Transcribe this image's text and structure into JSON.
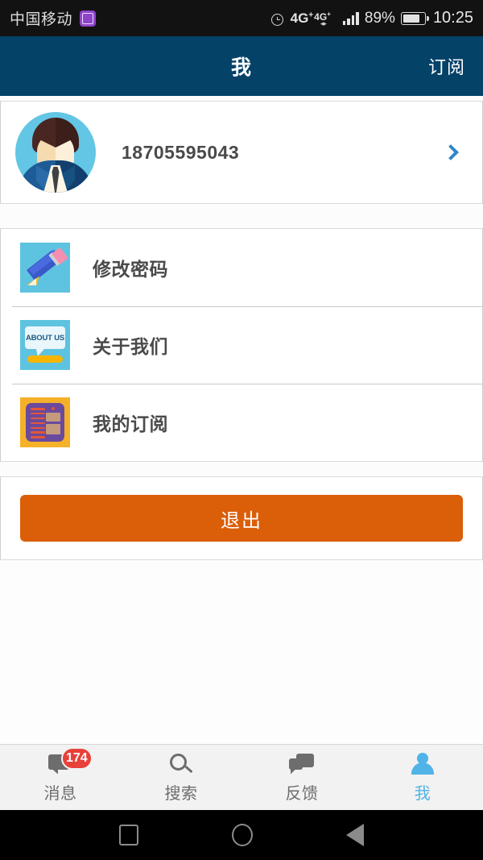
{
  "status_bar": {
    "carrier": "中国移动",
    "sim_icon": "sim-card-icon",
    "alarm_icon": "alarm-clock-icon",
    "network_primary": "4G",
    "network_primary_sup": "+",
    "network_secondary": "4G",
    "network_secondary_sup": "+",
    "data_arrows": "⇅",
    "signal_icon": "signal-bars-icon",
    "battery_percent": "89%",
    "battery_icon": "battery-icon",
    "battery_level": 89,
    "clock": "10:25"
  },
  "appbar": {
    "title": "我",
    "action_label": "订阅"
  },
  "profile": {
    "avatar_icon": "user-avatar-illustration",
    "phone": "18705595043",
    "chevron_icon": "chevron-right-icon",
    "accent_color": "#2f86c8"
  },
  "menu": {
    "items": [
      {
        "label": "修改密码",
        "icon": "pencil-icon",
        "icon_bg": "#5ec3e0"
      },
      {
        "label": "关于我们",
        "icon": "about-us-icon",
        "icon_bg": "#5ec3e0",
        "bubble_text": "ABOUT US"
      },
      {
        "label": "我的订阅",
        "icon": "newspaper-icon",
        "icon_bg": "#f5b12a"
      }
    ]
  },
  "logout": {
    "label": "退出",
    "color": "#db5e08"
  },
  "tabbar": {
    "items": [
      {
        "label": "消息",
        "icon": "chat-bubble-icon",
        "badge": "174",
        "active": false
      },
      {
        "label": "搜索",
        "icon": "search-icon",
        "badge": "",
        "active": false
      },
      {
        "label": "反馈",
        "icon": "feedback-bubbles-icon",
        "badge": "",
        "active": false
      },
      {
        "label": "我",
        "icon": "person-icon",
        "badge": "",
        "active": true
      }
    ],
    "badge_color": "#e8413a",
    "active_color": "#4fb3e8",
    "inactive_color": "#6d6d6d"
  },
  "android_nav": {
    "recents_icon": "square-recents-icon",
    "home_icon": "circle-home-icon",
    "back_icon": "triangle-back-icon"
  },
  "theme": {
    "appbar_bg": "#044268",
    "page_bg": "#fcfcfd",
    "card_bg": "#ffffff"
  }
}
